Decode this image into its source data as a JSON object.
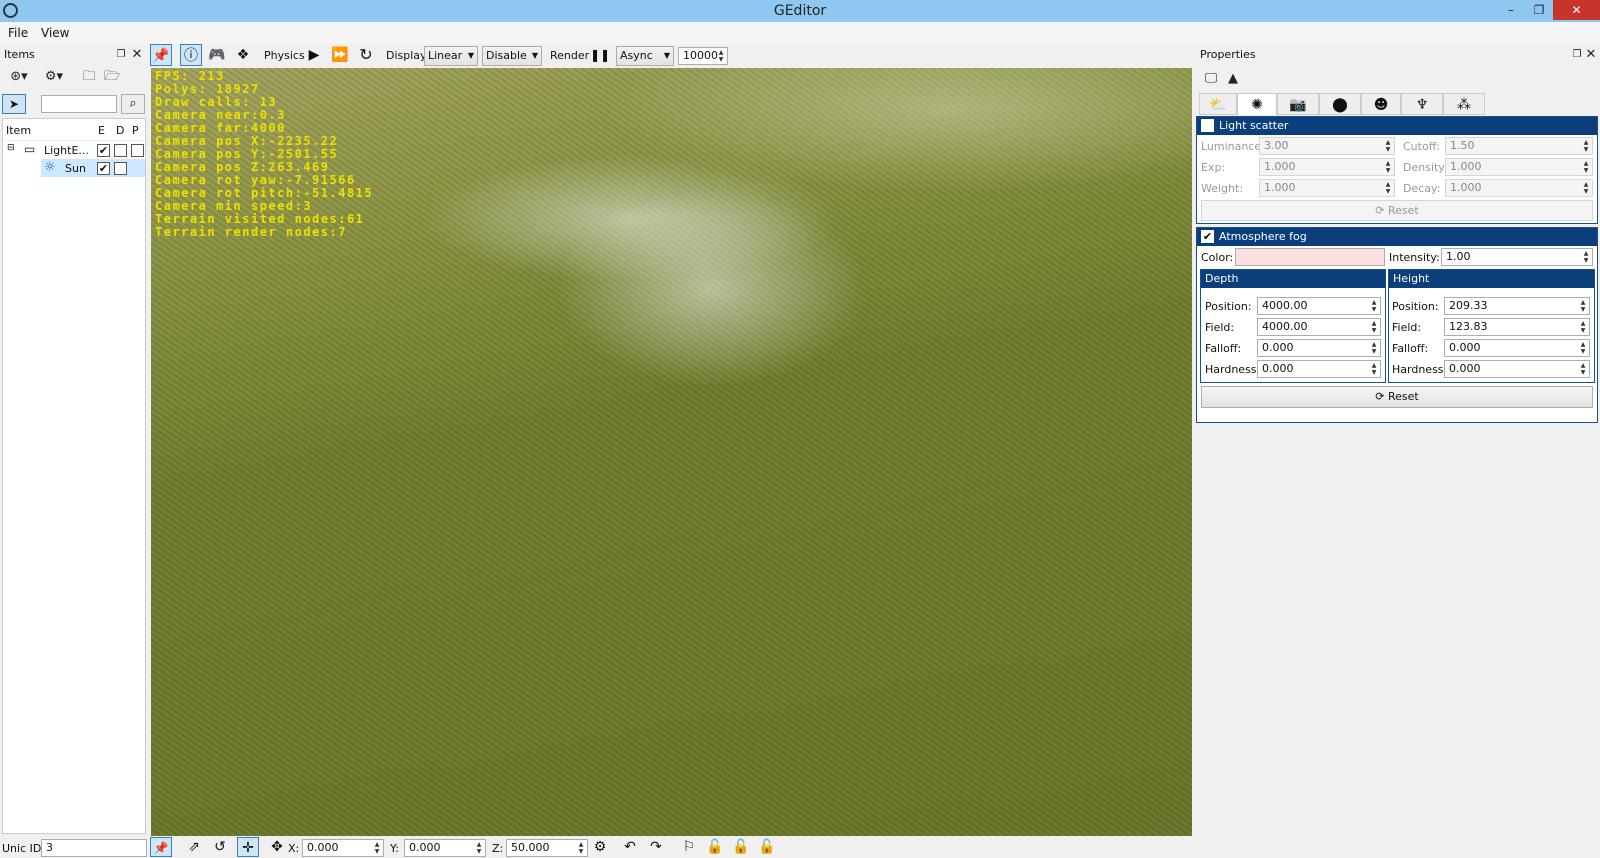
{
  "window": {
    "title": "GEditor",
    "minimize": "–",
    "restore": "❐",
    "close": "✕"
  },
  "menu": [
    "File",
    "View"
  ],
  "items_panel": {
    "title": "Items",
    "columns": {
      "item": "Item",
      "e": "E",
      "d": "D",
      "p": "P"
    },
    "rows": [
      {
        "label": "LightE...",
        "e": "✔",
        "d": "",
        "p": ""
      },
      {
        "label": "Sun",
        "e": "✔",
        "d": ""
      }
    ],
    "search_value": ""
  },
  "toolbar": {
    "physics_label": "Physics",
    "display_label": "Display",
    "display_value": "Linear",
    "disable_value": "Disable",
    "render_label": "Render",
    "async_value": "Async",
    "number_value": "10000"
  },
  "stats": [
    "FPS: 213",
    "Polys: 18927",
    "Draw calls: 13",
    "Camera near:0.3",
    "Camera far:4000",
    "Camera pos X:-2235.22",
    "Camera pos Y:-2501.55",
    "Camera pos Z:263.469",
    "Camera rot yaw:-7.91566",
    "Camera rot pitch:-51.4815",
    "Camera min speed:3",
    "Terrain visited nodes:61",
    "Terrain render nodes:7"
  ],
  "properties": {
    "title": "Properties",
    "light_scatter": {
      "title": "Light scatter",
      "checked": false,
      "luminance_label": "Luminance:",
      "luminance": "3.00",
      "cutoff_label": "Cutoff:",
      "cutoff": "1.50",
      "exp_label": "Exp:",
      "exp": "1.000",
      "density_label": "Density:",
      "density": "1.000",
      "weight_label": "Weight:",
      "weight": "1.000",
      "decay_label": "Decay:",
      "decay": "1.000",
      "reset": "Reset"
    },
    "fog": {
      "title": "Atmosphere fog",
      "checked": true,
      "color_label": "Color:",
      "color_value": "#fbe0df",
      "intensity_label": "Intensity:",
      "intensity": "1.00",
      "depth": {
        "title": "Depth",
        "position_label": "Position:",
        "position": "4000.00",
        "field_label": "Field:",
        "field": "4000.00",
        "falloff_label": "Falloff:",
        "falloff": "0.000",
        "hardness_label": "Hardness:",
        "hardness": "0.000"
      },
      "height": {
        "title": "Height",
        "position_label": "Position:",
        "position": "209.33",
        "field_label": "Field:",
        "field": "123.83",
        "falloff_label": "Falloff:",
        "falloff": "0.000",
        "hardness_label": "Hardness:",
        "hardness": "0.000"
      },
      "reset": "Reset"
    }
  },
  "bottom": {
    "unic_label": "Unic ID:",
    "unic_value": "3",
    "x_label": "X:",
    "x": "0.000",
    "y_label": "Y:",
    "y": "0.000",
    "z_label": "Z:",
    "z": "50.000"
  }
}
